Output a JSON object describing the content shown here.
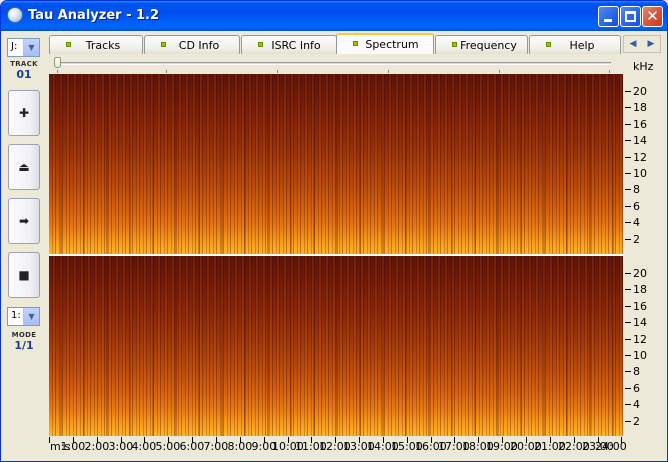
{
  "window": {
    "title": "Tau Analyzer - 1.2",
    "controls": {
      "minimize": "",
      "maximize": "",
      "close": "✕"
    }
  },
  "leftbar": {
    "drive_combo": "J:",
    "track_label": "TRACK",
    "track_value": "01",
    "buttons": [
      {
        "name": "add-button",
        "glyph": "✚"
      },
      {
        "name": "eject-button",
        "glyph": "⏏"
      },
      {
        "name": "play-button",
        "glyph": "➡"
      },
      {
        "name": "stop-button",
        "glyph": "■"
      }
    ],
    "mode_combo": "1:",
    "mode_label": "MODE",
    "mode_value": "1/1"
  },
  "tabs": [
    {
      "id": "tracks",
      "label": "Tracks",
      "active": false
    },
    {
      "id": "cd-info",
      "label": "CD Info",
      "active": false
    },
    {
      "id": "isrc-info",
      "label": "ISRC Info",
      "active": false
    },
    {
      "id": "spectrum",
      "label": "Spectrum",
      "active": true
    },
    {
      "id": "frequency",
      "label": "Frequency",
      "active": false
    },
    {
      "id": "help",
      "label": "Help",
      "active": false
    }
  ],
  "tab_scroll": {
    "left": "◀",
    "right": "▶"
  },
  "spectrum": {
    "y_unit": "kHz",
    "y_ticks": [
      "20",
      "18",
      "16",
      "14",
      "12",
      "10",
      "8",
      "6",
      "4",
      "2"
    ],
    "time_axis_label": "m:s",
    "time_ticks": [
      "1:00",
      "2:00",
      "3:00",
      "4:00",
      "5:00",
      "6:00",
      "7:00",
      "8:00",
      "9:00",
      "10:00",
      "11:00",
      "12:00",
      "13:00",
      "14:00",
      "15:00",
      "16:00",
      "17:00",
      "18:00",
      "19:00",
      "20:00",
      "21:00",
      "22:00",
      "23:00",
      "24:00"
    ]
  },
  "colors": {
    "title_bar": "#0053ee",
    "spectrum_low": "#ffb52a",
    "spectrum_high": "#5e1408",
    "track_value": "#1e3f8c",
    "tab_highlight": "#ffc83c"
  }
}
